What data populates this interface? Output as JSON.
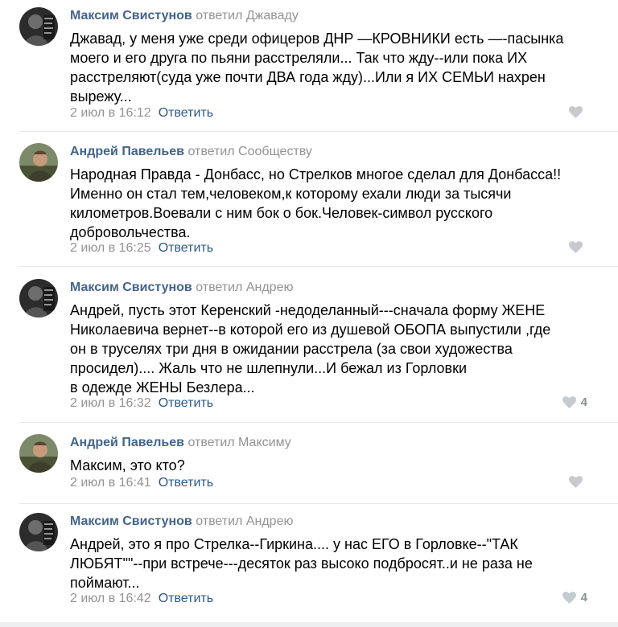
{
  "comments": [
    {
      "author": "Максим Свистунов",
      "action": "ответил Джаваду",
      "lines": [
        "Джавад, у меня уже среди офицеров ДНР —КРОВНИКИ есть —-пасынка",
        "моего и его друга по пьяни расстреляли... Так что жду--или пока ИХ",
        "расстреляют(суда уже почти ДВА года жду)...Или я ИХ СЕМЬИ нахрен",
        "вырежу..."
      ],
      "date": "2 июл в 16:12",
      "reply": "Ответить",
      "likes": ""
    },
    {
      "author": "Андрей Павельев",
      "action": "ответил Сообществу",
      "lines": [
        "Народная Правда - Донбасс, но Стрелков многое сделал для Донбасса!!",
        "Именно он стал тем,человеком,к которому ехали люди за тысячи",
        "километров.Воевали с ним бок о бок.Человек-символ русского",
        "добровольчества."
      ],
      "date": "2 июл в 16:25",
      "reply": "Ответить",
      "likes": ""
    },
    {
      "author": "Максим Свистунов",
      "action": "ответил Андрею",
      "lines": [
        "Андрей, пусть этот Керенский -недоделанный---сначала форму ЖЕНЕ",
        "Николаевича вернет--в которой его из душевой ОБОПА выпустили ,где",
        "он в труселях три дня в ожидании расстрела (за свои художества",
        "просидел).... Жаль что не шлепнули...И бежал из Горловки",
        "в одежде ЖЕНЫ Безлера..."
      ],
      "date": "2 июл в 16:32",
      "reply": "Ответить",
      "likes": "4"
    },
    {
      "author": "Андрей Павельев",
      "action": "ответил Максиму",
      "lines": [
        "Максим, это кто?"
      ],
      "date": "2 июл в 16:41",
      "reply": "Ответить",
      "likes": ""
    },
    {
      "author": "Максим Свистунов",
      "action": "ответил Андрею",
      "lines": [
        "Андрей, это я про Стрелка--Гиркина.... у нас ЕГО в Горловке--\"ТАК",
        "ЛЮБЯТ\"\"--при встрече---десяток раз высоко подбросят..и не раза не",
        "поймают..."
      ],
      "date": "2 июл в 16:42",
      "reply": "Ответить",
      "likes": "4"
    }
  ],
  "colors": {
    "author": "#42648b",
    "muted": "#939393",
    "link": "#2a5885",
    "divider": "#e7e8ec",
    "heart": "#c5cbd1"
  },
  "icons": {
    "like": "heart-icon"
  }
}
